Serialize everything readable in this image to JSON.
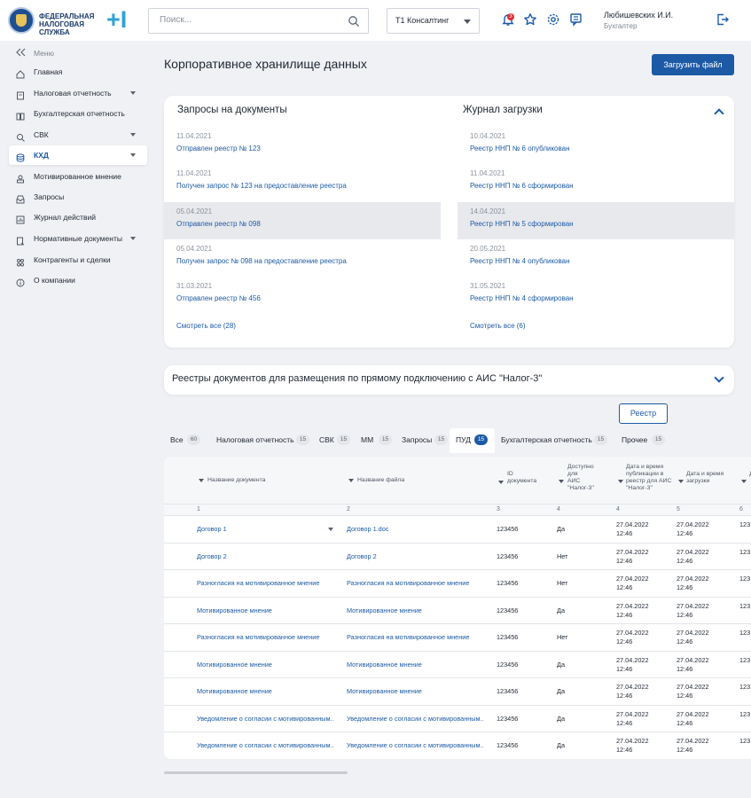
{
  "header": {
    "logo_line1": "ФЕДЕРАЛЬНАЯ",
    "logo_line2": "НАЛОГОВАЯ СЛУЖБА",
    "logo_plus": "+I",
    "search_placeholder": "Поиск...",
    "company": "Т1 Консалтинг",
    "notification_count": "3",
    "user_name": "Любишевских И.И.",
    "user_role": "Бухгалтер"
  },
  "sidebar": {
    "toggle_label": "Меню",
    "items": [
      {
        "label": "Главная",
        "icon": "home-icon"
      },
      {
        "label": "Налоговая отчетность",
        "icon": "doc-icon",
        "has_caret": true
      },
      {
        "label": "Бухгалтерская отчетность",
        "icon": "book-icon"
      },
      {
        "label": "СВК",
        "icon": "search-doc-icon",
        "has_caret": true
      },
      {
        "label": "КХД",
        "icon": "database-icon",
        "has_caret": true,
        "active": true
      },
      {
        "label": "Мотивированное мнение",
        "icon": "stamp-icon"
      },
      {
        "label": "Запросы",
        "icon": "inbox-icon"
      },
      {
        "label": "Журнал действий",
        "icon": "chart-icon"
      },
      {
        "label": "Нормативные документы",
        "icon": "legal-doc-icon",
        "has_caret": true
      },
      {
        "label": "Контрагенты и сделки",
        "icon": "partners-icon"
      },
      {
        "label": "О компании",
        "icon": "info-icon"
      }
    ]
  },
  "main": {
    "title": "Корпоративное хранилище данных",
    "upload_button": "Загрузить файл",
    "requests": {
      "title": "Запросы на документы",
      "items": [
        {
          "date": "11.04.2021",
          "text": "Отправлен реестр № 123"
        },
        {
          "date": "11.04.2021",
          "text": "Получен запрос № 123 на предоставление реестра"
        },
        {
          "date": "05.04.2021",
          "text": "Отправлен реестр № 098"
        },
        {
          "date": "05.04.2021",
          "text": "Получен запрос № 098 на предоставление реестра"
        },
        {
          "date": "31.03.2021",
          "text": "Отправлен реестр № 456"
        }
      ],
      "see_all": "Смотреть все (28)"
    },
    "journal": {
      "title": "Журнал загрузки",
      "items": [
        {
          "date": "10.04.2021",
          "text": "Реестр ННП № 6 опубликован"
        },
        {
          "date": "11.04.2021",
          "text": "Реестр ННП № 6 сформирован"
        },
        {
          "date": "14.04.2021",
          "text": "Реестр ННП № 5 сформирован"
        },
        {
          "date": "20.05.2021",
          "text": "Реестр ННП № 4 опубликован"
        },
        {
          "date": "31.05.2021",
          "text": "Реестр ННП № 4 сформирован"
        }
      ],
      "see_all": "Смотреть все (6)"
    },
    "registries_title": "Реестры документов для размещения по прямому подключению с  АИС \"Налог-3\"",
    "reestr_button": "Реестр",
    "tabs": [
      {
        "label": "Все",
        "count": "60"
      },
      {
        "label": "Налоговая отчетность",
        "count": "15"
      },
      {
        "label": "СВК",
        "count": "15"
      },
      {
        "label": "ММ",
        "count": "15"
      },
      {
        "label": "Запросы",
        "count": "15"
      },
      {
        "label": "ПУД",
        "count": "15",
        "active": true
      },
      {
        "label": "Бухгалтерская отчетность",
        "count": "15"
      },
      {
        "label": "Прочее",
        "count": "15"
      }
    ],
    "table": {
      "headers": [
        "Название документа",
        "Название файла",
        "ID\nдокумента",
        "Доступно\nдля\nАИС\n\"Налог-3\"",
        "Дата и время\nпубликации в\nреестр для АИС\n\"Налог-3\"",
        "Дата и время\nзагрузки",
        "Д..."
      ],
      "col_numbers": [
        "1",
        "2",
        "3",
        "4",
        "4",
        "5",
        "6"
      ],
      "rows": [
        {
          "doc": "Договор 1",
          "file": "Договор 1.doc",
          "id": "123456",
          "avail": "Да",
          "pub_date": "27.04.2022",
          "pub_time": "12:46",
          "load_date": "27.04.2022",
          "load_time": "12:46",
          "extra": "123"
        },
        {
          "doc": "Договор 2",
          "file": "Договор 2",
          "id": "123456",
          "avail": "Нет",
          "pub_date": "27.04.2022",
          "pub_time": "12:46",
          "load_date": "27.04.2022",
          "load_time": "12:46",
          "extra": "123"
        },
        {
          "doc": "Разногласия на мотивированное мнение",
          "file": "Разногласия на мотивированное мнение",
          "id": "123456",
          "avail": "Нет",
          "pub_date": "27.04.2022",
          "pub_time": "12:46",
          "load_date": "27.04.2022",
          "load_time": "12:46",
          "extra": "123"
        },
        {
          "doc": "Мотивированное мнение",
          "file": "Мотивированное мнение",
          "id": "123456",
          "avail": "Да",
          "pub_date": "27.04.2022",
          "pub_time": "12:46",
          "load_date": "27.04.2022",
          "load_time": "12:46",
          "extra": "123"
        },
        {
          "doc": "Разногласия на мотивированное мнение",
          "file": "Разногласия на мотивированное мнение",
          "id": "123456",
          "avail": "Нет",
          "pub_date": "27.04.2022",
          "pub_time": "12:46",
          "load_date": "27.04.2022",
          "load_time": "12:46",
          "extra": "123"
        },
        {
          "doc": "Мотивированное мнение",
          "file": "Мотивированное мнение",
          "id": "123456",
          "avail": "Да",
          "pub_date": "27.04.2022",
          "pub_time": "12:46",
          "load_date": "27.04.2022",
          "load_time": "12:46",
          "extra": "123"
        },
        {
          "doc": "Мотивированное мнение",
          "file": "Мотивированное мнение",
          "id": "123456",
          "avail": "Да",
          "pub_date": "27.04.2022",
          "pub_time": "12:46",
          "load_date": "27.04.2022",
          "load_time": "12:46",
          "extra": "123"
        },
        {
          "doc": "Уведомление о согласии с мотивированным..",
          "file": "Уведомление о согласии с мотивированным..",
          "id": "123456",
          "avail": "Да",
          "pub_date": "27.04.2022",
          "pub_time": "12:46",
          "load_date": "27.04.2022",
          "load_time": "12:46",
          "extra": "123"
        },
        {
          "doc": "Уведомление о согласии с мотивированным..",
          "file": "Уведомление о согласии с мотивированным..",
          "id": "123456",
          "avail": "Да",
          "pub_date": "27.04.2022",
          "pub_time": "12:46",
          "load_date": "27.04.2022",
          "load_time": "12:46",
          "extra": "123"
        }
      ]
    }
  },
  "colors": {
    "accent": "#1d5aa6",
    "page_bg": "#f0f1f4",
    "highlight": "#e8e9ed",
    "badge": "#d93030"
  }
}
